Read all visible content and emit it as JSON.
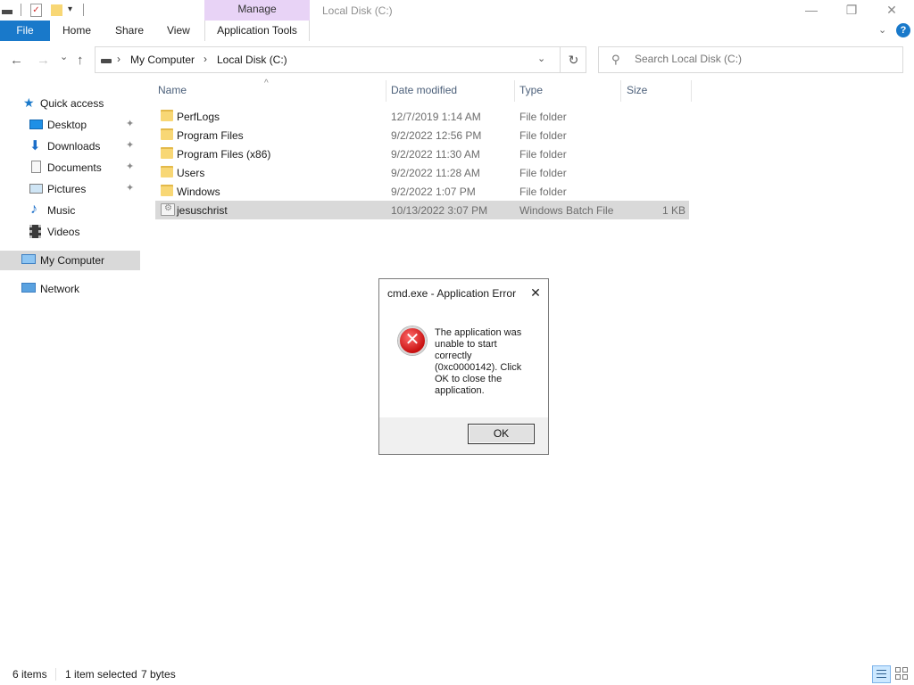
{
  "titlebar": {
    "manage_label": "Manage",
    "window_title": "Local Disk (C:)",
    "minimize_glyph": "—",
    "maximize_glyph": "❐",
    "close_glyph": "✕"
  },
  "ribbon": {
    "file_label": "File",
    "tabs": [
      "Home",
      "Share",
      "View"
    ],
    "apptools_label": "Application Tools",
    "collapse_glyph": "⌄",
    "help_glyph": "?"
  },
  "nav": {
    "back_glyph": "←",
    "forward_glyph": "→",
    "recent_glyph": "⌄",
    "up_glyph": "↑",
    "breadcrumbs": [
      "My Computer",
      "Local Disk (C:)"
    ],
    "separator": "›",
    "dropdown_glyph": "⌄",
    "refresh_glyph": "↻",
    "search_placeholder": "Search Local Disk (C:)",
    "search_glyph": "⚲"
  },
  "sidebar": {
    "quick_access": "Quick access",
    "items": [
      {
        "label": "Desktop",
        "pinned": true
      },
      {
        "label": "Downloads",
        "pinned": true
      },
      {
        "label": "Documents",
        "pinned": true
      },
      {
        "label": "Pictures",
        "pinned": true
      },
      {
        "label": "Music",
        "pinned": false
      },
      {
        "label": "Videos",
        "pinned": false
      }
    ],
    "my_computer": "My Computer",
    "network": "Network",
    "pin_glyph": "📌"
  },
  "filelist": {
    "columns": {
      "name": "Name",
      "date": "Date modified",
      "type": "Type",
      "size": "Size"
    },
    "sort_glyph": "^",
    "rows": [
      {
        "name": "PerfLogs",
        "date": "12/7/2019 1:14 AM",
        "type": "File folder",
        "size": ""
      },
      {
        "name": "Program Files",
        "date": "9/2/2022 12:56 PM",
        "type": "File folder",
        "size": ""
      },
      {
        "name": "Program Files (x86)",
        "date": "9/2/2022 11:30 AM",
        "type": "File folder",
        "size": ""
      },
      {
        "name": "Users",
        "date": "9/2/2022 11:28 AM",
        "type": "File folder",
        "size": ""
      },
      {
        "name": "Windows",
        "date": "9/2/2022 1:07 PM",
        "type": "File folder",
        "size": ""
      },
      {
        "name": "jesuschrist",
        "date": "10/13/2022 3:07 PM",
        "type": "Windows Batch File",
        "size": "1 KB"
      }
    ]
  },
  "dialog": {
    "title": "cmd.exe - Application Error",
    "close_glyph": "✕",
    "error_glyph": "✕",
    "message": "The application was unable to start correctly (0xc0000142). Click OK to close the application.",
    "ok_label": "OK"
  },
  "status": {
    "items_count": "6 items",
    "selection": "1 item selected",
    "size": "7 bytes"
  }
}
